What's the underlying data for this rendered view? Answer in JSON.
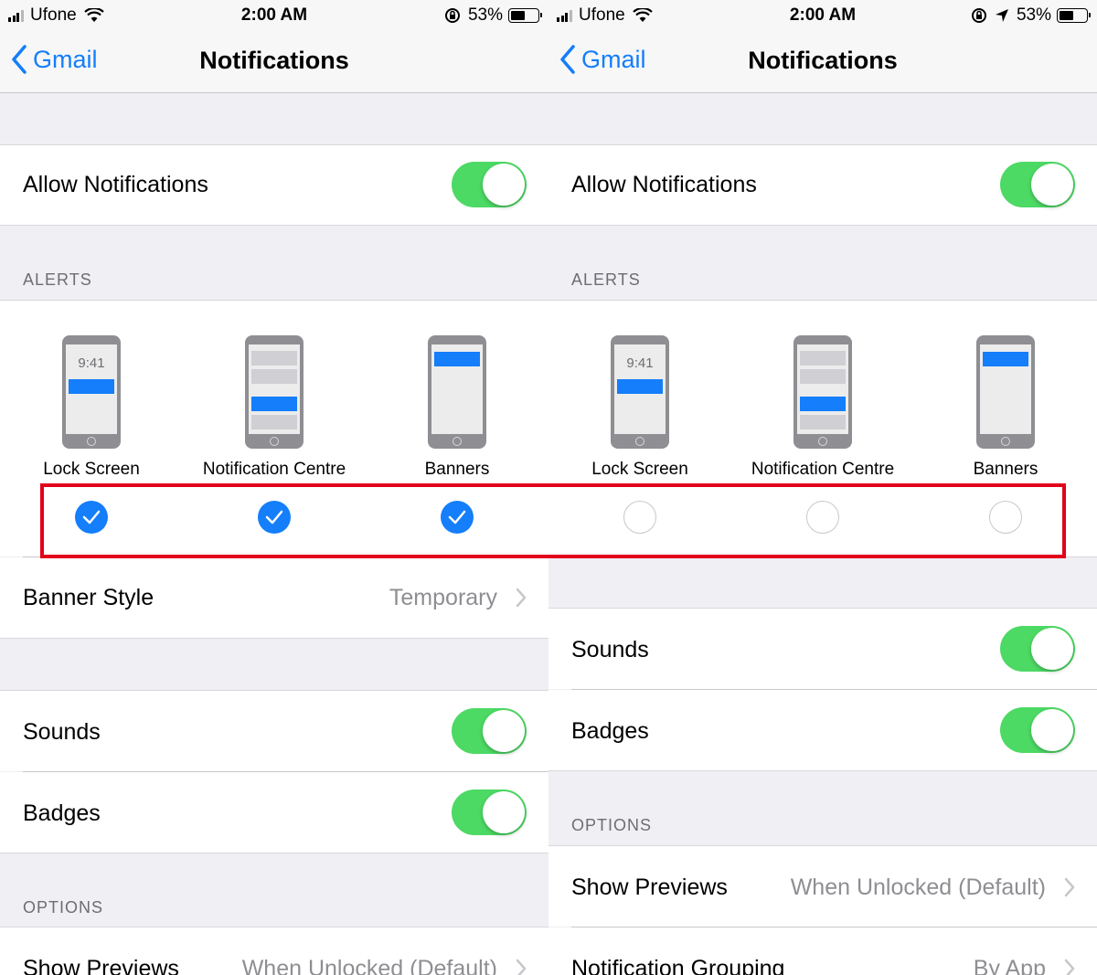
{
  "status_bar": {
    "carrier": "Ufone",
    "time": "2:00 AM",
    "battery": "53%",
    "icons": [
      "signal-icon",
      "wifi-icon",
      "rotation-lock-icon",
      "location-icon",
      "battery-icon"
    ]
  },
  "nav": {
    "back_label": "Gmail",
    "title": "Notifications"
  },
  "allow_notifications": {
    "label": "Allow Notifications",
    "on": true
  },
  "alerts": {
    "header": "ALERTS",
    "lock_screen_time": "9:41",
    "styles": [
      {
        "label": "Lock Screen"
      },
      {
        "label": "Notification Centre"
      },
      {
        "label": "Banners"
      }
    ]
  },
  "left_screen": {
    "alerts_checked": [
      true,
      true,
      true
    ],
    "banner_style": {
      "label": "Banner Style",
      "value": "Temporary"
    }
  },
  "right_screen": {
    "alerts_checked": [
      false,
      false,
      false
    ]
  },
  "sounds": {
    "label": "Sounds",
    "on": true
  },
  "badges": {
    "label": "Badges",
    "on": true
  },
  "options": {
    "header": "OPTIONS",
    "show_previews": {
      "label": "Show Previews",
      "value": "When Unlocked (Default)"
    },
    "notification_grouping": {
      "label": "Notification Grouping",
      "value": "By App"
    }
  },
  "colors": {
    "accent": "#147efb",
    "toggle_on": "#4cd964",
    "highlight": "#e2001a"
  }
}
